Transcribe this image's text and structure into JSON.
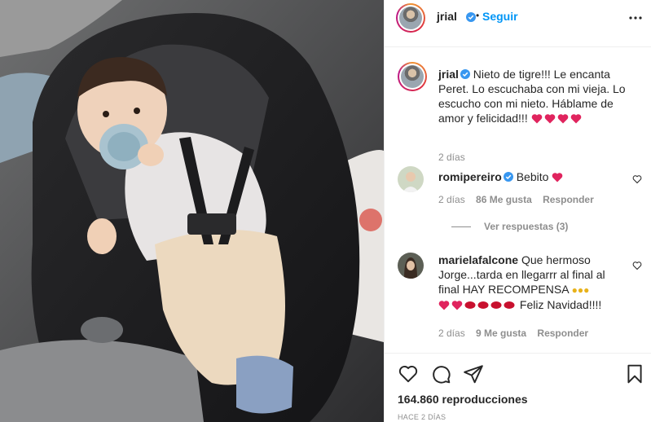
{
  "post": {
    "username": "jrial",
    "follow_label": "Seguir",
    "dot": "•"
  },
  "caption": {
    "username": "jrial",
    "text": "Nieto de tigre!!! Le encanta Peret. Lo escuchaba con mi vieja. Lo escucho con mi nieto. Háblame de amor y felicidad!!!",
    "time": "2 días"
  },
  "comments": [
    {
      "username": "romipereiro",
      "text": "Bebito",
      "time": "2 días",
      "likes": "86 Me gusta",
      "reply_label": "Responder",
      "view_replies": "Ver respuestas (3)"
    },
    {
      "username": "marielafalcone",
      "text": "Que hermoso Jorge...tarda en llegarrr al final al final HAY RECOMPENSA",
      "text_end": "Feliz Navidad!!!!",
      "time": "2 días",
      "likes": "9 Me gusta",
      "reply_label": "Responder"
    }
  ],
  "footer": {
    "views": "164.860 reproducciones",
    "posted": "HACE 2 DÍAS"
  },
  "colors": {
    "accent": "#0095f6",
    "verified": "#3897f0",
    "heart": "#e0245e",
    "muted": "#8e8e8e"
  },
  "icons": [
    "verified-icon",
    "more-options-icon",
    "heart-icon",
    "comment-icon",
    "share-icon",
    "bookmark-icon"
  ]
}
